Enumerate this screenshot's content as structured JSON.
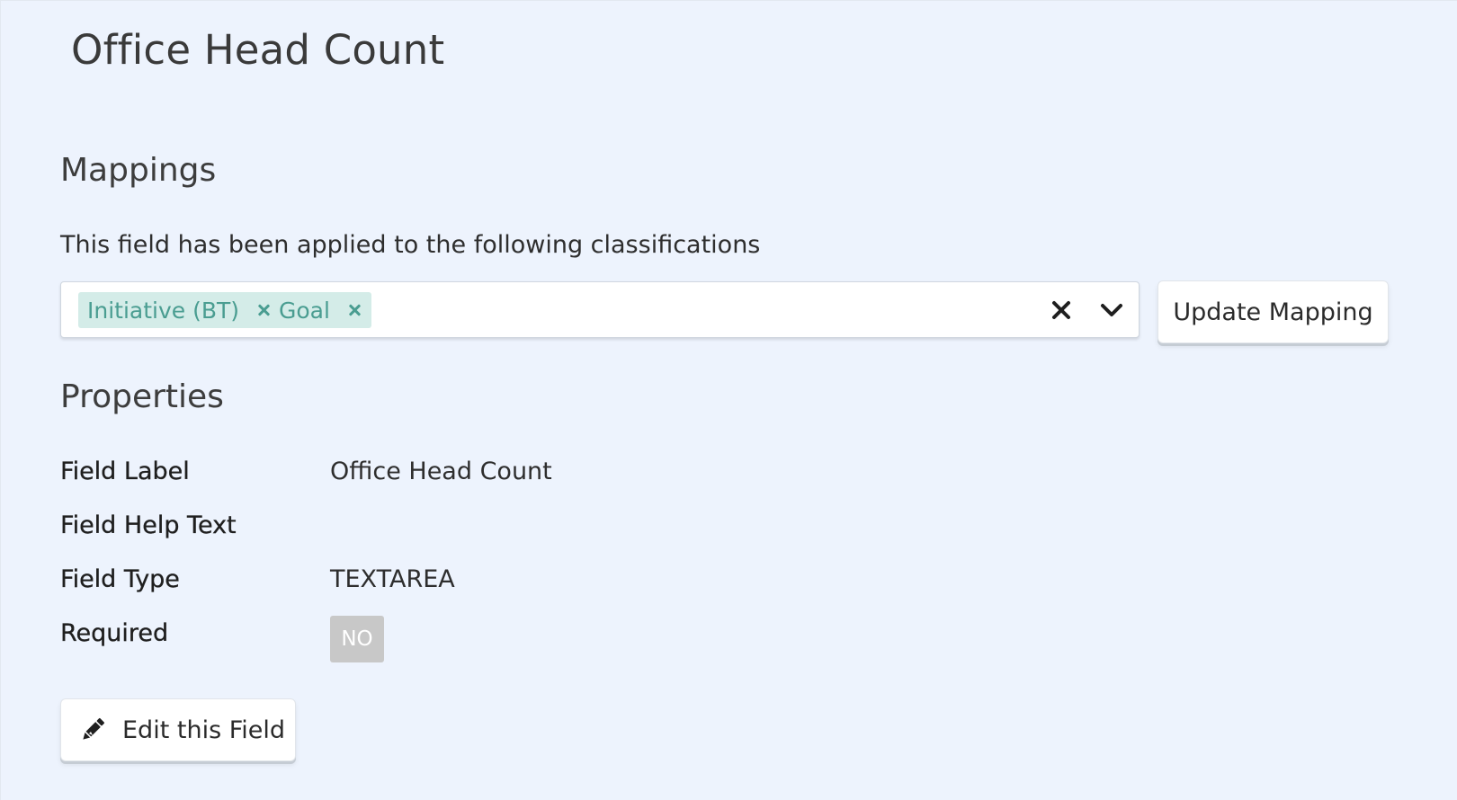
{
  "header": {
    "title": "Office Head Count"
  },
  "mappings": {
    "heading": "Mappings",
    "description": "This field has been applied to the following classifications",
    "selected": [
      {
        "label": "Initiative (BT)"
      },
      {
        "label": "Goal"
      }
    ],
    "update_label": "Update Mapping"
  },
  "properties": {
    "heading": "Properties",
    "rows": [
      {
        "label": "Field Label",
        "value": "Office Head Count"
      },
      {
        "label": "Field Help Text",
        "value": ""
      },
      {
        "label": "Field Type",
        "value": "TEXTAREA"
      },
      {
        "label": "Required",
        "value": "NO"
      }
    ]
  },
  "actions": {
    "edit_label": "Edit this Field"
  },
  "icons": {
    "chip_remove": "close-icon",
    "clear": "close-icon",
    "toggle": "chevron-down-icon",
    "edit": "pencil-icon"
  },
  "colors": {
    "background": "#edf3fd",
    "chip_bg": "#d4ece8",
    "chip_text": "#4a9d91",
    "badge_no_bg": "#c8c8c8"
  }
}
